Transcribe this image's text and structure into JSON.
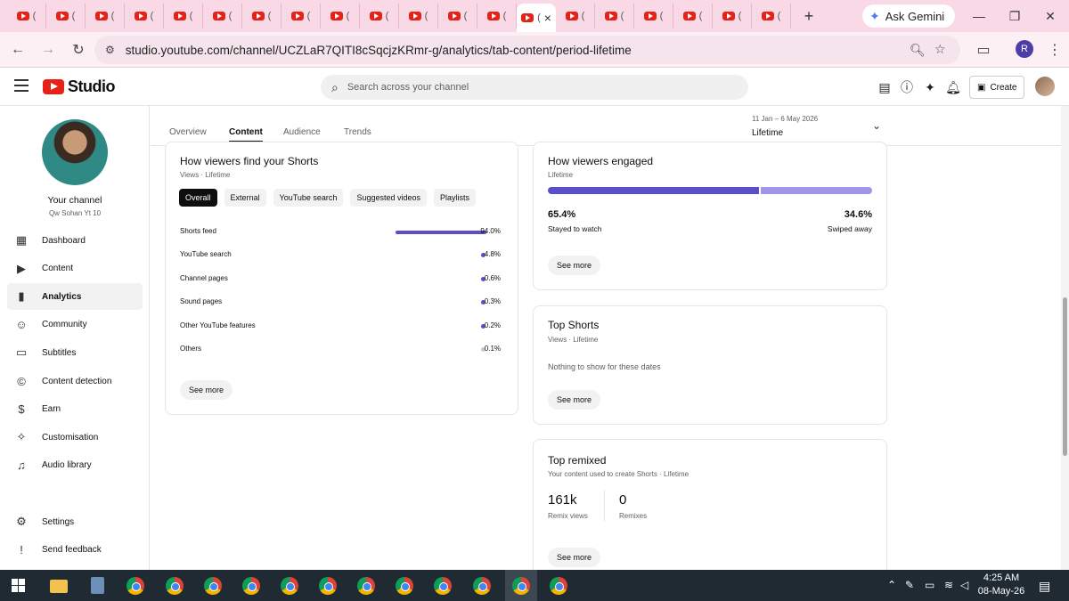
{
  "browser": {
    "tab_paren": "(",
    "active_tab_close": "×",
    "new_tab": "+",
    "ask_gemini": "Ask Gemini",
    "url": "studio.youtube.com/channel/UCZLaR7QITI8cSqcjzKRmr-g/analytics/tab-content/period-lifetime",
    "profile_initial": "R"
  },
  "studio": {
    "logo_text": "Studio",
    "search_placeholder": "Search across your channel",
    "create_label": "Create"
  },
  "sidebar": {
    "channel_title": "Your channel",
    "channel_name": "Qw Sohan Yt 10",
    "items": [
      {
        "label": "Dashboard",
        "icon": "dashboard-icon"
      },
      {
        "label": "Content",
        "icon": "content-icon"
      },
      {
        "label": "Analytics",
        "icon": "analytics-icon",
        "active": true
      },
      {
        "label": "Community",
        "icon": "community-icon"
      },
      {
        "label": "Subtitles",
        "icon": "subtitles-icon"
      },
      {
        "label": "Content detection",
        "icon": "copyright-icon"
      },
      {
        "label": "Earn",
        "icon": "dollar-icon"
      },
      {
        "label": "Customisation",
        "icon": "magic-wand-icon"
      },
      {
        "label": "Audio library",
        "icon": "audio-library-icon"
      }
    ],
    "footer": [
      {
        "label": "Settings",
        "icon": "gear-icon"
      },
      {
        "label": "Send feedback",
        "icon": "feedback-icon"
      }
    ]
  },
  "analytics": {
    "tabs": [
      "Overview",
      "Content",
      "Audience",
      "Trends"
    ],
    "active_tab": "Content",
    "period_range": "11 Jan – 6 May 2026",
    "period_name": "Lifetime"
  },
  "find_shorts": {
    "title": "How viewers find your Shorts",
    "subtitle": "Views · Lifetime",
    "chips": [
      "Overall",
      "External",
      "YouTube search",
      "Suggested videos",
      "Playlists"
    ],
    "active_chip": "Overall",
    "rows": [
      {
        "name": "Shorts feed",
        "value": 94.0,
        "pct": "94.0%"
      },
      {
        "name": "YouTube search",
        "value": 4.8,
        "pct": "4.8%"
      },
      {
        "name": "Channel pages",
        "value": 0.6,
        "pct": "0.6%"
      },
      {
        "name": "Sound pages",
        "value": 0.3,
        "pct": "0.3%"
      },
      {
        "name": "Other YouTube features",
        "value": 0.2,
        "pct": "0.2%"
      },
      {
        "name": "Others",
        "value": 0.1,
        "pct": "0.1%"
      }
    ],
    "see_more": "See more"
  },
  "engaged": {
    "title": "How viewers engaged",
    "subtitle": "Lifetime",
    "stayed_value": 65.4,
    "stayed_pct": "65.4%",
    "stayed_label": "Stayed to watch",
    "swiped_value": 34.6,
    "swiped_pct": "34.6%",
    "swiped_label": "Swiped away",
    "see_more": "See more",
    "colors": {
      "stayed": "#5a4fc4",
      "swiped": "#9e96e6"
    }
  },
  "top_shorts": {
    "title": "Top Shorts",
    "subtitle": "Views · Lifetime",
    "empty": "Nothing to show for these dates",
    "see_more": "See more"
  },
  "top_remixed": {
    "title": "Top remixed",
    "subtitle": "Your content used to create Shorts · Lifetime",
    "remix_views": "161k",
    "remix_views_label": "Remix views",
    "remixes": "0",
    "remixes_label": "Remixes",
    "see_more": "See more"
  },
  "taskbar": {
    "time": "4:25 AM",
    "date": "08-May-26"
  }
}
